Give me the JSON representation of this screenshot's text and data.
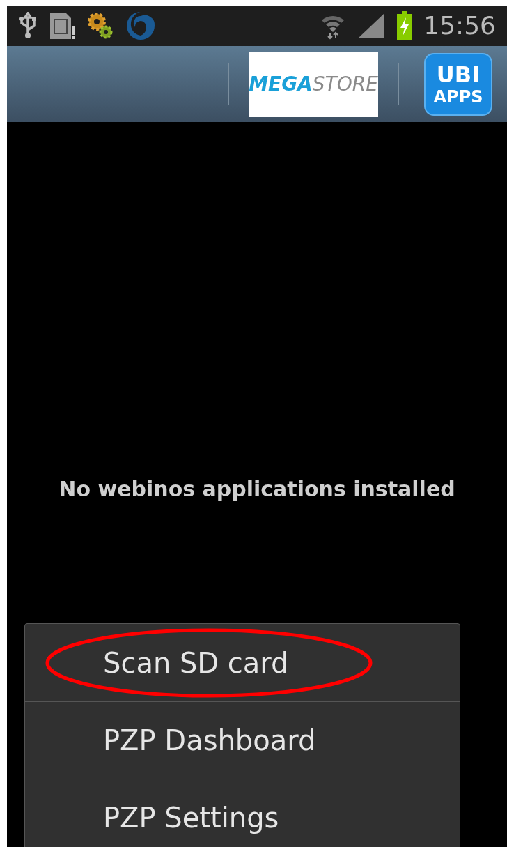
{
  "status_bar": {
    "time": "15:56",
    "battery_charging": true
  },
  "action_bar": {
    "store_logo": {
      "bold_part": "MEGA",
      "light_part": "STORE"
    },
    "apps_logo": {
      "line_1": "UBI",
      "line_2": "APPS"
    }
  },
  "empty_message": "No webinos applications installed",
  "menu": [
    {
      "label": "Scan SD card",
      "highlighted": true
    },
    {
      "label": "PZP Dashboard",
      "highlighted": false
    },
    {
      "label": "PZP Settings",
      "highlighted": false
    }
  ]
}
